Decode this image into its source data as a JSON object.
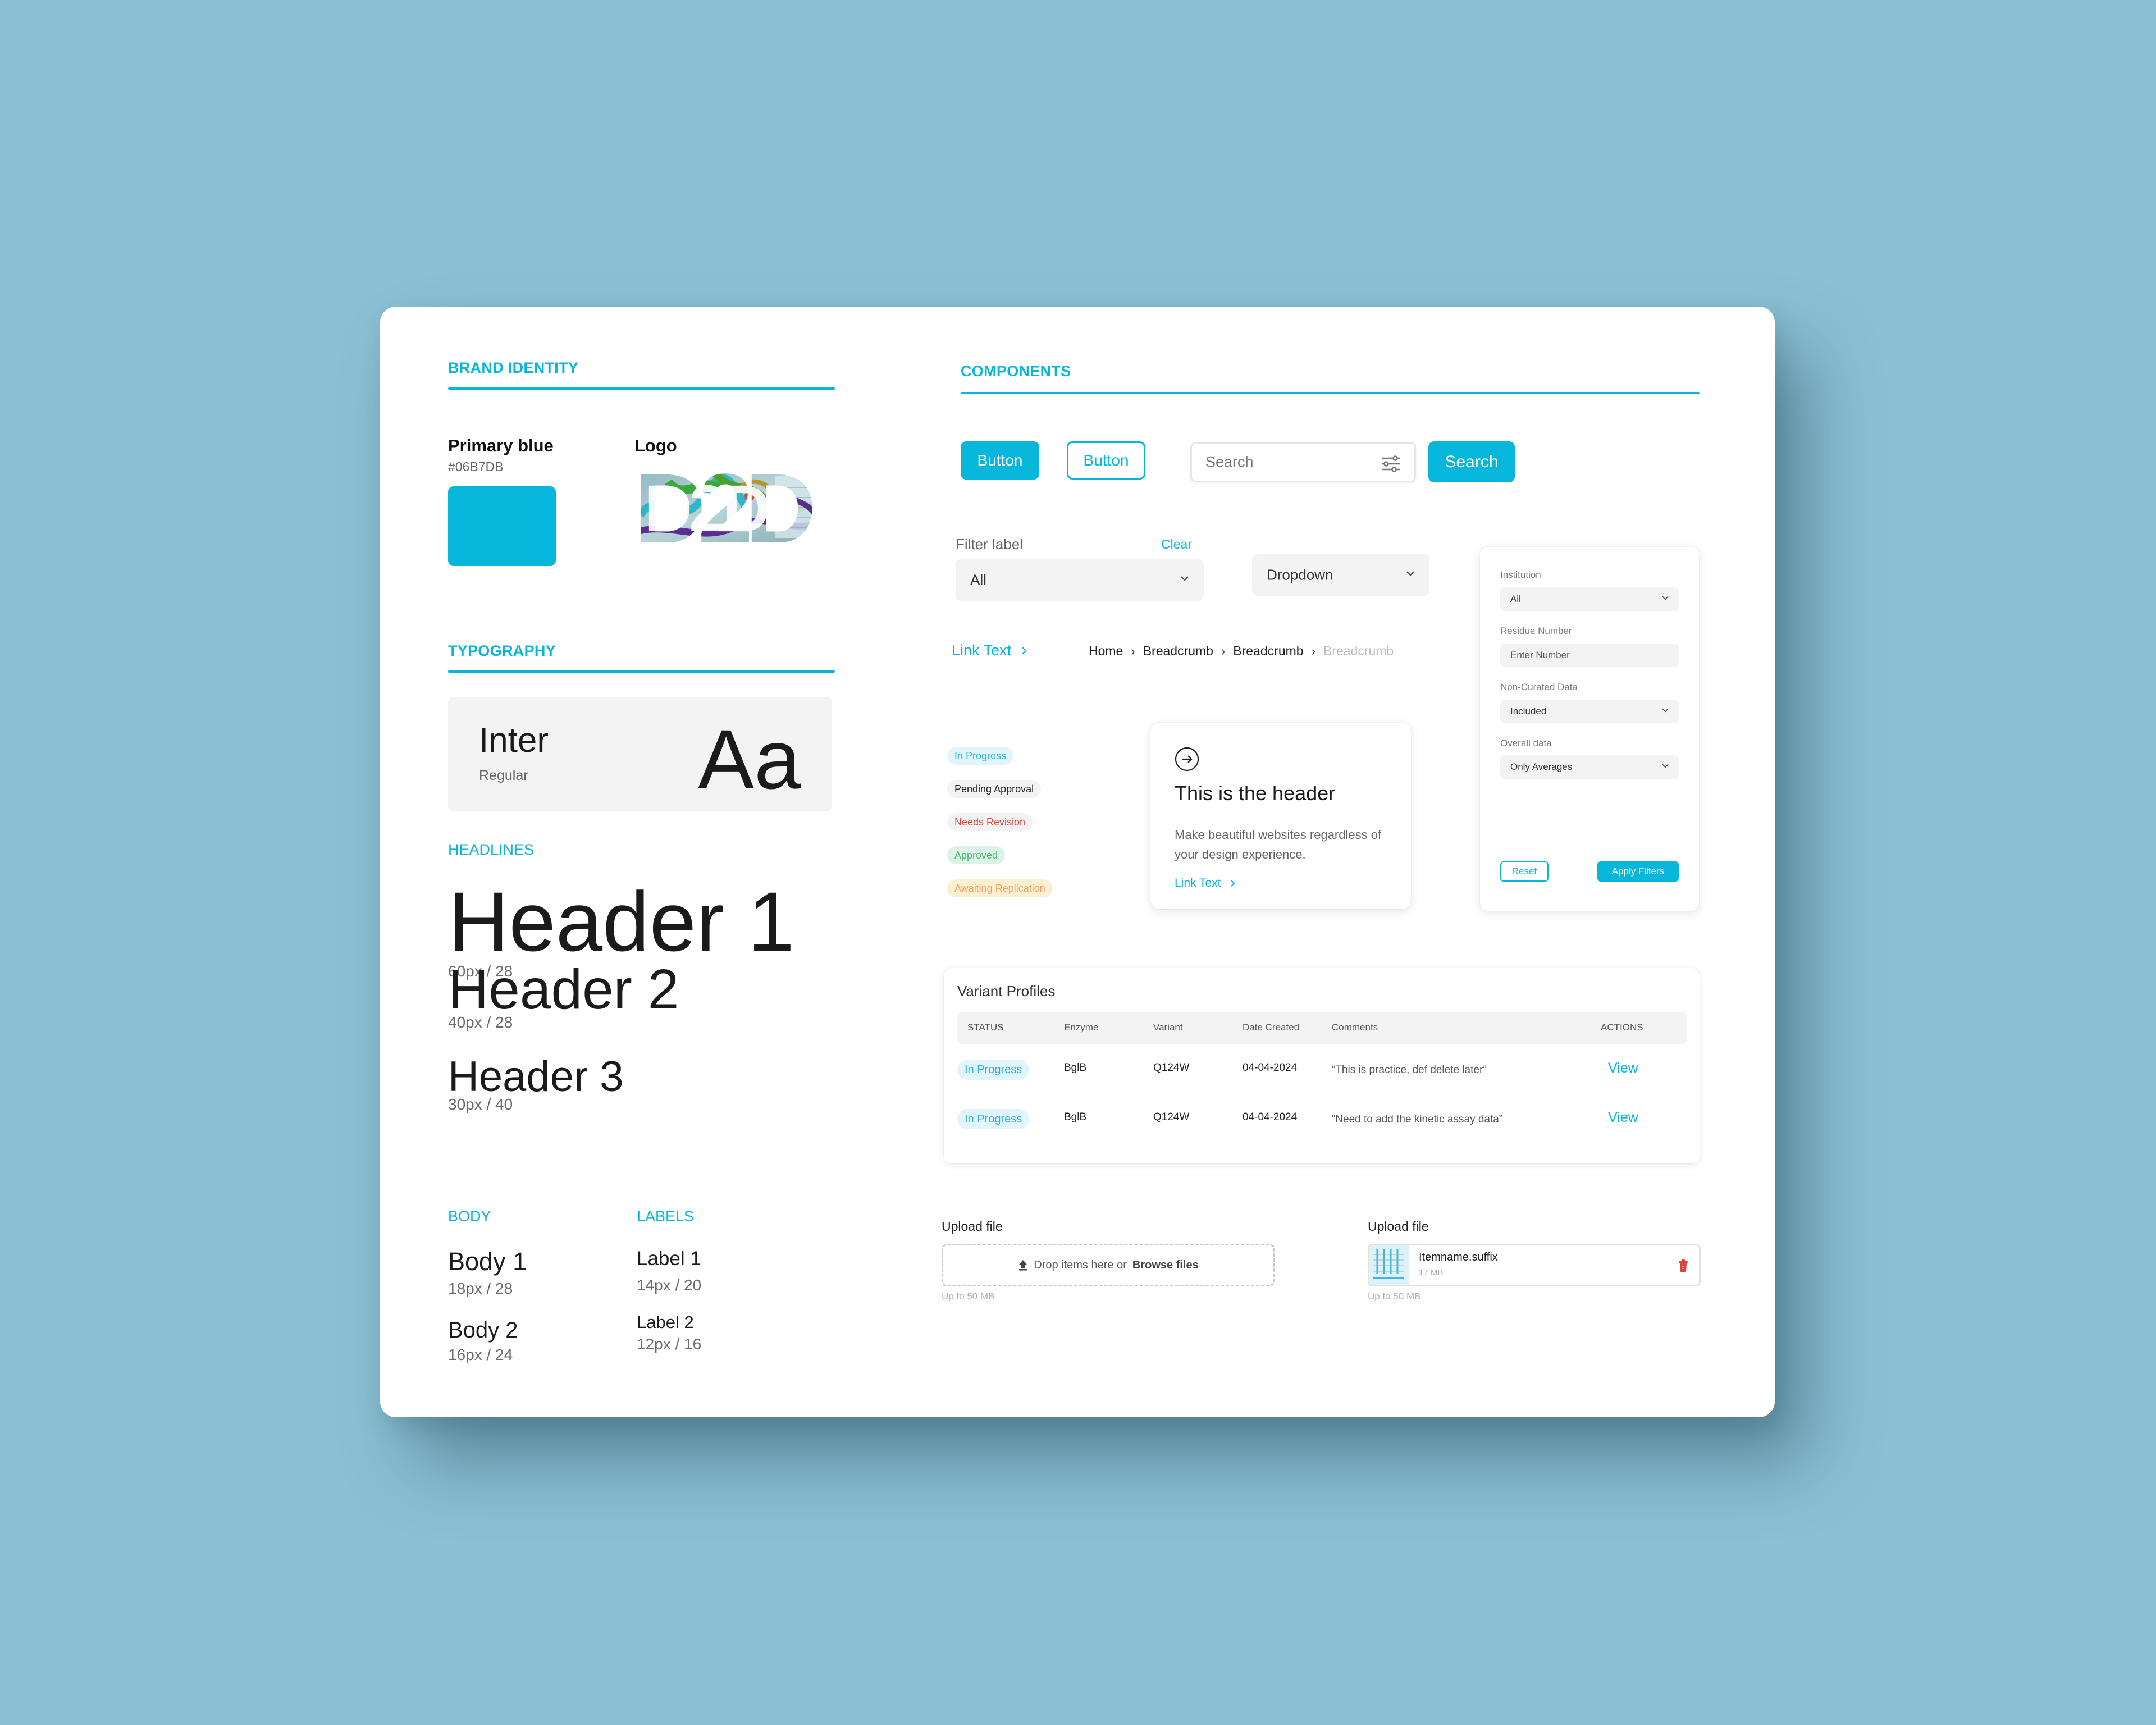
{
  "brand": {
    "section_title": "BRAND IDENTITY",
    "primary_label": "Primary blue",
    "primary_hex": "#06B7DB",
    "primary_color": "#06B7DB",
    "logo_label": "Logo",
    "logo_text": "D2D"
  },
  "typography": {
    "section_title": "TYPOGRAPHY",
    "font_name": "Inter",
    "font_weight": "Regular",
    "sample": "Aa",
    "headlines_title": "HEADLINES",
    "headlines": [
      {
        "label": "Header 1",
        "spec": "60px / 28"
      },
      {
        "label": "Header 2",
        "spec": "40px / 28"
      },
      {
        "label": "Header 3",
        "spec": "30px / 40"
      }
    ],
    "body_title": "BODY",
    "body": [
      {
        "label": "Body 1",
        "spec": "18px / 28"
      },
      {
        "label": "Body 2",
        "spec": "16px / 24"
      }
    ],
    "labels_title": "LABELS",
    "labels": [
      {
        "label": "Label 1",
        "spec": "14px / 20"
      },
      {
        "label": "Label 2",
        "spec": "12px / 16"
      }
    ]
  },
  "components": {
    "section_title": "COMPONENTS",
    "button_primary": "Button",
    "button_outline": "Button",
    "search_placeholder": "Search",
    "search_button": "Search",
    "filter": {
      "label": "Filter label",
      "clear": "Clear",
      "value": "All"
    },
    "dropdown": {
      "value": "Dropdown"
    },
    "link_text": "Link Text",
    "breadcrumb": [
      "Home",
      "Breadcrumb",
      "Breadcrumb",
      "Breadcrumb"
    ],
    "badges": [
      {
        "label": "In Progress",
        "fg": "#1FB5DE",
        "bg": "#E3F5FC"
      },
      {
        "label": "Pending Approval",
        "fg": "#222222",
        "bg": "#F3F3F3"
      },
      {
        "label": "Needs Revision",
        "fg": "#E0413A",
        "bg": "#F3F3F3"
      },
      {
        "label": "Approved",
        "fg": "#4DB86A",
        "bg": "#DDF2E8"
      },
      {
        "label": "Awaiting Replication",
        "fg": "#F2A45C",
        "bg": "#FDEFD2"
      }
    ],
    "info_card": {
      "title": "This is the header",
      "body": "Make beautiful websites regardless of your design experience.",
      "link": "Link Text"
    },
    "filter_panel": {
      "fields": [
        {
          "label": "Institution",
          "value": "All",
          "type": "select"
        },
        {
          "label": "Residue Number",
          "value": "Enter Number",
          "type": "input"
        },
        {
          "label": "Non-Curated Data",
          "value": "Included",
          "type": "select"
        },
        {
          "label": "Overall data",
          "value": "Only Averages",
          "type": "select"
        }
      ],
      "reset": "Reset",
      "apply": "Apply Filters"
    },
    "table": {
      "title": "Variant Profiles",
      "columns": [
        "STATUS",
        "Enzyme",
        "Variant",
        "Date Created",
        "Comments",
        "ACTIONS"
      ],
      "rows": [
        {
          "status": "In Progress",
          "enzyme": "BglB",
          "variant": "Q124W",
          "date": "04-04-2024",
          "comment": "“This is practice, def delete later”",
          "action": "View"
        },
        {
          "status": "In Progress",
          "enzyme": "BglB",
          "variant": "Q124W",
          "date": "04-04-2024",
          "comment": "“Need to add the kinetic assay data”",
          "action": "View"
        }
      ]
    },
    "upload_empty": {
      "label": "Upload file",
      "drop_text": "Drop items here or",
      "browse": "Browse files",
      "hint": "Up to 50 MB"
    },
    "upload_filled": {
      "label": "Upload file",
      "file_name": "Itemname.suffix",
      "file_size": "17 MB",
      "hint": "Up to 50 MB"
    }
  }
}
